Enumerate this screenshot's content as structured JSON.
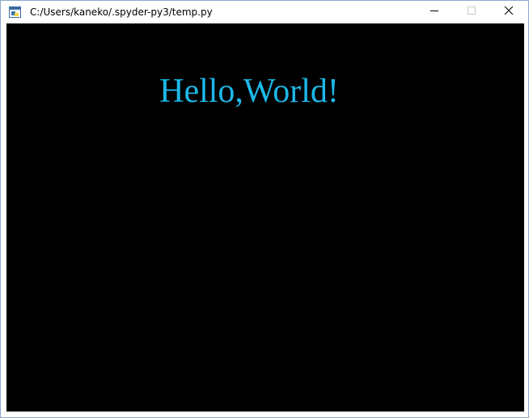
{
  "window": {
    "title": "C:/Users/kaneko/.spyder-py3/temp.py",
    "icon": "python-app-icon",
    "controls": {
      "minimize_icon": "minimize-icon",
      "maximize_icon": "maximize-icon",
      "close_icon": "close-icon"
    }
  },
  "canvas": {
    "background": "#000000",
    "text": "Hello,World!",
    "text_color": "#1cb8e8"
  }
}
